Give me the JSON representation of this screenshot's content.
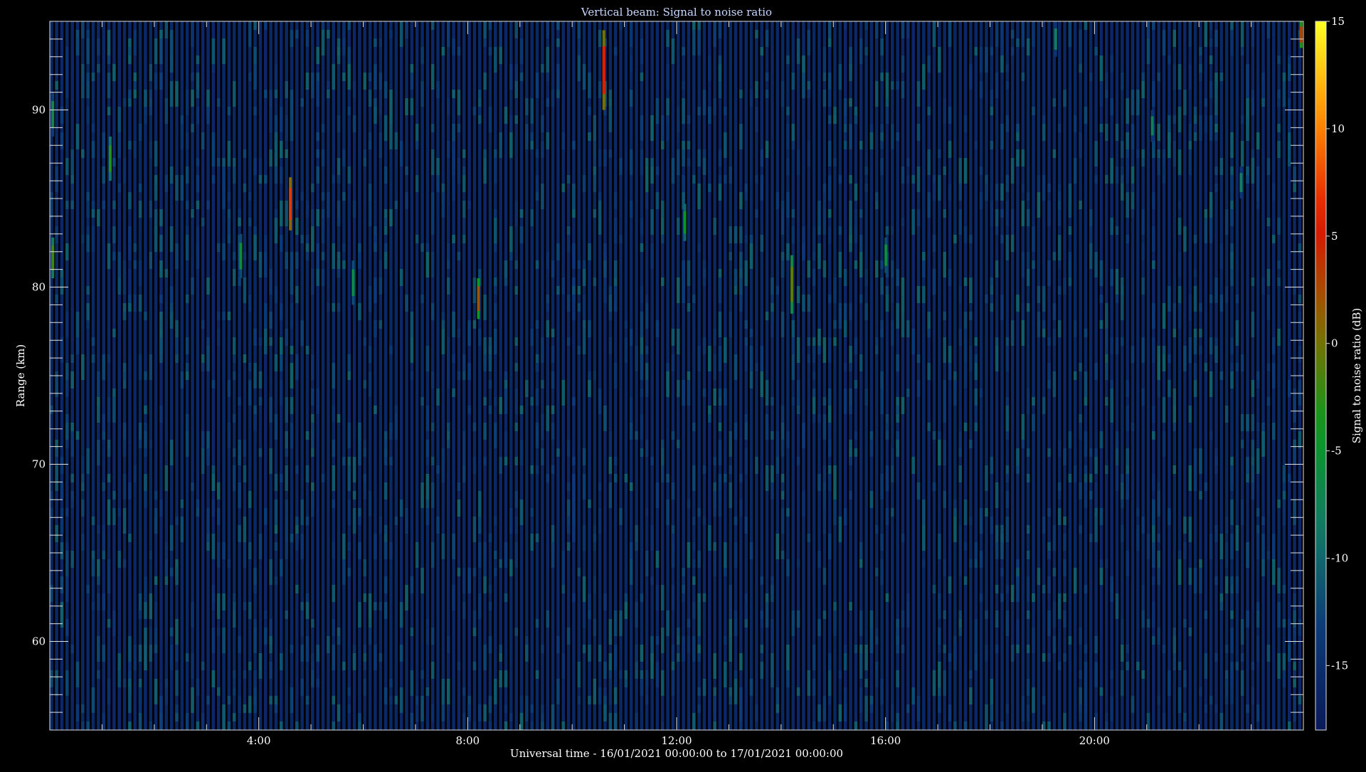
{
  "chart_data": {
    "type": "heatmap",
    "title": "Vertical beam: Signal to noise ratio",
    "xlabel": "Universal time - 16/01/2021 00:00:00 to 17/01/2021 00:00:00",
    "ylabel": "Range (km)",
    "colorbar_label": "Signal to noise ratio (dB)",
    "x_unit": "hours UT",
    "xlim": [
      0,
      24
    ],
    "ylim": [
      55,
      95
    ],
    "x_tick_values": [
      4,
      8,
      12,
      16,
      20
    ],
    "x_tick_labels": [
      "4:00",
      "8:00",
      "12:00",
      "16:00",
      "20:00"
    ],
    "y_tick_values": [
      60,
      70,
      80,
      90
    ],
    "y_tick_labels": [
      "60",
      "70",
      "80",
      "90"
    ],
    "colorbar_range": [
      -18,
      15
    ],
    "colorbar_tick_values": [
      15,
      10,
      5,
      0,
      -5,
      -10,
      -15
    ],
    "colorbar_tick_labels": [
      "15",
      "10",
      "5",
      "0",
      "-5",
      "-10",
      "-15"
    ],
    "colorscale": [
      "#0a1a5a",
      "#0b3a7a",
      "#137a66",
      "#0a9a1e",
      "#8a6a00",
      "#e01000",
      "#ff8800",
      "#ffff20"
    ],
    "background_snr_db": -16,
    "echoes": [
      {
        "time_h": 0.05,
        "range_km": [
          80.5,
          82.8
        ],
        "snr_db": -2
      },
      {
        "time_h": 0.05,
        "range_km": [
          88.5,
          91.0
        ],
        "snr_db": -7
      },
      {
        "time_h": 1.15,
        "range_km": [
          86.0,
          88.5
        ],
        "snr_db": -3
      },
      {
        "time_h": 3.65,
        "range_km": [
          80.5,
          83.0
        ],
        "snr_db": -6
      },
      {
        "time_h": 4.6,
        "range_km": [
          83.2,
          86.2
        ],
        "snr_db": 7
      },
      {
        "time_h": 5.8,
        "range_km": [
          79.0,
          81.5
        ],
        "snr_db": -6
      },
      {
        "time_h": 8.2,
        "range_km": [
          78.2,
          80.5
        ],
        "snr_db": 2
      },
      {
        "time_h": 10.6,
        "range_km": [
          90.0,
          94.5
        ],
        "snr_db": 6
      },
      {
        "time_h": 12.15,
        "range_km": [
          82.6,
          84.7
        ],
        "snr_db": -4
      },
      {
        "time_h": 14.2,
        "range_km": [
          78.5,
          81.8
        ],
        "snr_db": -1
      },
      {
        "time_h": 16.0,
        "range_km": [
          80.8,
          82.8
        ],
        "snr_db": -6
      },
      {
        "time_h": 19.25,
        "range_km": [
          93.0,
          95.0
        ],
        "snr_db": -8
      },
      {
        "time_h": 21.1,
        "range_km": [
          88.2,
          90.0
        ],
        "snr_db": -8
      },
      {
        "time_h": 22.8,
        "range_km": [
          85.0,
          86.8
        ],
        "snr_db": -8
      },
      {
        "time_h": 23.95,
        "range_km": [
          93.5,
          95.0
        ],
        "snr_db": 3
      }
    ]
  }
}
